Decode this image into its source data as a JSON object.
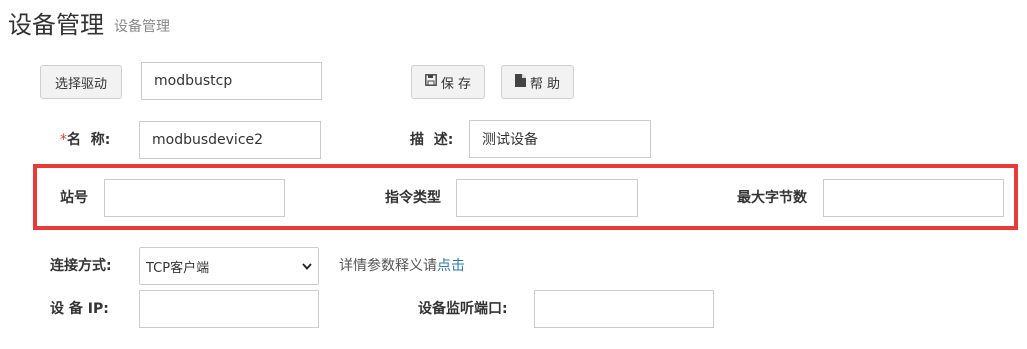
{
  "page": {
    "title": "设备管理",
    "subtitle": "设备管理"
  },
  "toolbar": {
    "select_driver_label": "选择驱动",
    "driver_value": "modbustcp",
    "save_label": "保 存",
    "help_label": "帮 助"
  },
  "form": {
    "name": {
      "required_mark": "*",
      "label": "名  称:",
      "value": "modbusdevice2"
    },
    "description": {
      "label": "描  述:",
      "value": "测试设备"
    },
    "station": {
      "label": "站号",
      "value": ""
    },
    "command_type": {
      "label": "指令类型",
      "value": ""
    },
    "max_bytes": {
      "label": "最大字节数",
      "value": ""
    },
    "connection": {
      "label": "连接方式:",
      "value": "TCP客户端"
    },
    "hint": {
      "text": "详情参数释义请",
      "link": "点击"
    },
    "ip": {
      "label": "设 备 IP:",
      "value": ""
    },
    "port": {
      "label": "设备监听端口:",
      "value": ""
    }
  },
  "colors": {
    "highlight_border": "#ea3b3b",
    "link": "#2a7ab0"
  }
}
